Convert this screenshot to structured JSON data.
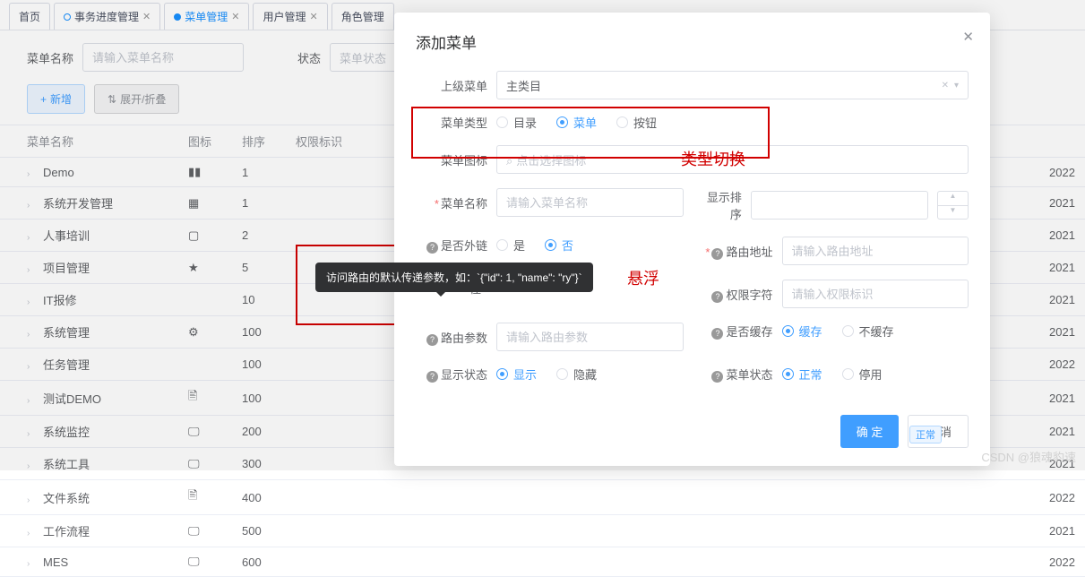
{
  "tabs": [
    {
      "label": "首页",
      "closable": false
    },
    {
      "label": "事务进度管理",
      "closable": true
    },
    {
      "label": "菜单管理",
      "closable": true,
      "active": true
    },
    {
      "label": "用户管理",
      "closable": true
    },
    {
      "label": "角色管理",
      "closable": true
    }
  ],
  "search": {
    "name_label": "菜单名称",
    "name_placeholder": "请输入菜单名称",
    "status_label": "状态",
    "status_placeholder": "菜单状态"
  },
  "toolbar": {
    "add": "新增",
    "expand": "展开/折叠"
  },
  "table": {
    "cols": {
      "name": "菜单名称",
      "icon": "图标",
      "sort": "排序",
      "perm": "权限标识",
      "year": ""
    },
    "rows": [
      {
        "name": "Demo",
        "icon": "▮▮",
        "sort": "1",
        "year": "2022"
      },
      {
        "name": "系统开发管理",
        "icon": "▦",
        "sort": "1",
        "year": "2021"
      },
      {
        "name": "人事培训",
        "icon": "▢",
        "sort": "2",
        "year": "2021"
      },
      {
        "name": "项目管理",
        "icon": "★",
        "sort": "5",
        "year": "2021"
      },
      {
        "name": "IT报修",
        "icon": "",
        "sort": "10",
        "year": "2021"
      },
      {
        "name": "系统管理",
        "icon": "⚙",
        "sort": "100",
        "year": "2021"
      },
      {
        "name": "任务管理",
        "icon": "",
        "sort": "100",
        "year": "2022"
      },
      {
        "name": "测试DEMO",
        "icon": "🖹",
        "sort": "100",
        "year": "2021"
      },
      {
        "name": "系统监控",
        "icon": "🖵",
        "sort": "200",
        "year": "2021"
      },
      {
        "name": "系统工具",
        "icon": "🖵",
        "sort": "300",
        "year": "2021"
      },
      {
        "name": "文件系统",
        "icon": "🖹",
        "sort": "400",
        "year": "2022"
      },
      {
        "name": "工作流程",
        "icon": "🖵",
        "sort": "500",
        "year": "2021"
      },
      {
        "name": "MES",
        "icon": "🖵",
        "sort": "600",
        "year": "2022"
      }
    ],
    "status_normal": "正常"
  },
  "modal": {
    "title": "添加菜单",
    "parent": {
      "label": "上级菜单",
      "value": "主类目"
    },
    "type": {
      "label": "菜单类型",
      "options": [
        "目录",
        "菜单",
        "按钮"
      ],
      "selected": 1
    },
    "icon": {
      "label": "菜单图标",
      "placeholder": "点击选择图标"
    },
    "name": {
      "label": "菜单名称",
      "placeholder": "请输入菜单名称"
    },
    "sort": {
      "label": "显示排序"
    },
    "external": {
      "label": "是否外链",
      "options": [
        "是",
        "否"
      ],
      "selected": 1
    },
    "route": {
      "label": "路由地址",
      "placeholder": "请输入路由地址"
    },
    "perm": {
      "label": "权限字符",
      "placeholder": "请输入权限标识"
    },
    "params": {
      "label": "路由参数",
      "placeholder": "请输入路由参数",
      "path_hint": "径"
    },
    "cache": {
      "label": "是否缓存",
      "options": [
        "缓存",
        "不缓存"
      ],
      "selected": 0
    },
    "display": {
      "label": "显示状态",
      "options": [
        "显示",
        "隐藏"
      ],
      "selected": 0
    },
    "status": {
      "label": "菜单状态",
      "options": [
        "正常",
        "停用"
      ],
      "selected": 0
    },
    "confirm": "确 定",
    "cancel": "取 消"
  },
  "tooltip": "访问路由的默认传递参数，如：`{\"id\": 1, \"name\": \"ry\"}`",
  "annotations": {
    "type_switch": "类型切换",
    "hover": "悬浮"
  },
  "watermark": "CSDN @狼魂豹速"
}
